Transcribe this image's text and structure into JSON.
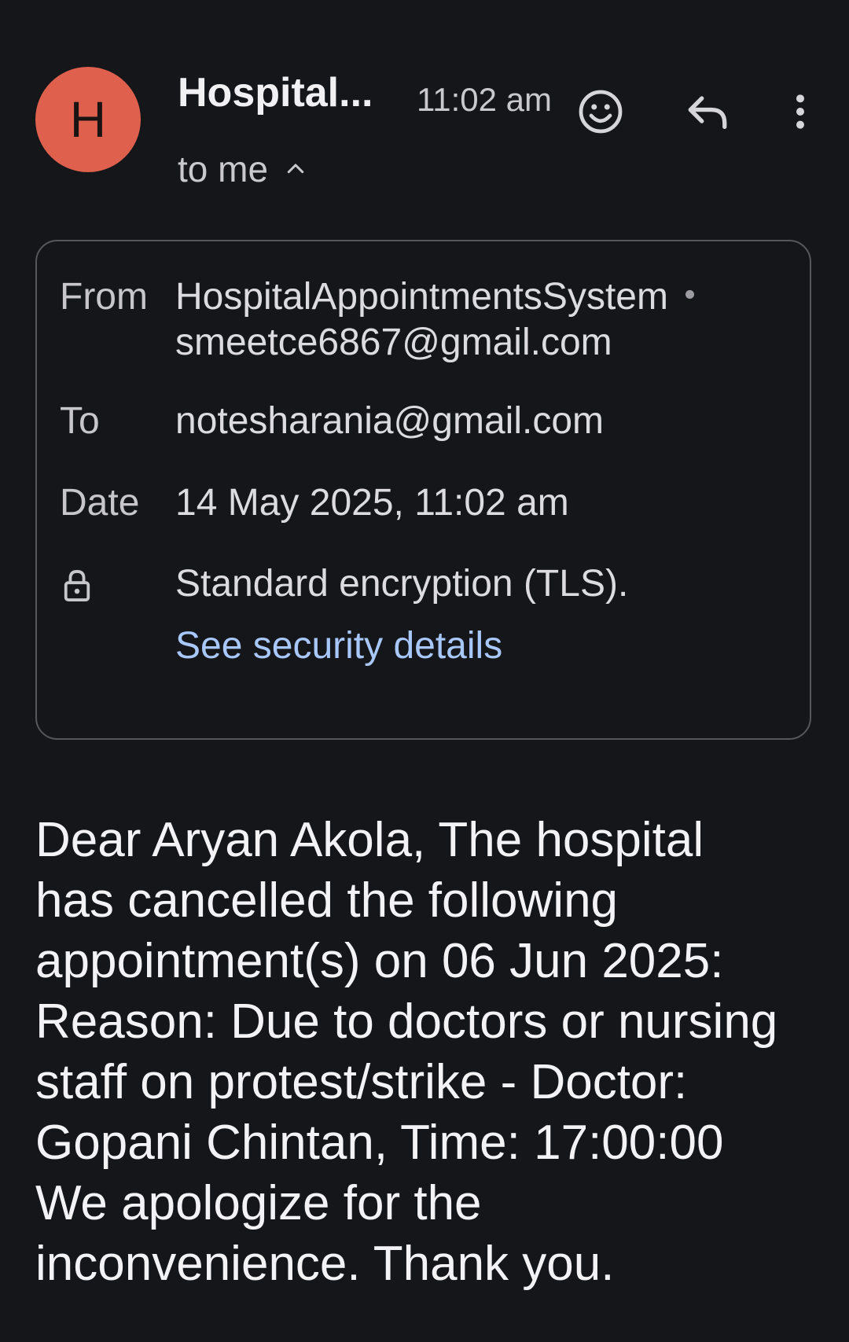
{
  "header": {
    "avatar_letter": "H",
    "sender_short": "Hospital...",
    "time": "11:02 am",
    "to_me": "to me",
    "icons": {
      "emoji": "emoji-smile-icon",
      "reply": "reply-icon",
      "more": "more-vertical-icon",
      "expand": "chevron-up-icon"
    },
    "avatar_color": "#e0604e"
  },
  "details": {
    "from_label": "From",
    "from_name": "HospitalAppointmentsSystem",
    "from_email": "smeetce6867@gmail.com",
    "to_label": "To",
    "to_value": "notesharania@gmail.com",
    "date_label": "Date",
    "date_value": "14 May 2025, 11:02 am",
    "encryption_icon": "lock-icon",
    "encryption_text": "Standard encryption (TLS).",
    "security_link": "See security details",
    "link_color": "#a8c7fa"
  },
  "message": {
    "lines": [
      "Dear Aryan Akola, The hospital",
      "has cancelled the following",
      "appointment(s) on 06 Jun 2025:",
      "Reason: Due to doctors or nursing",
      "staff on protest/strike - Doctor:",
      "Gopani Chintan, Time: 17:00:00",
      "We apologize for the",
      "inconvenience. Thank you."
    ]
  }
}
